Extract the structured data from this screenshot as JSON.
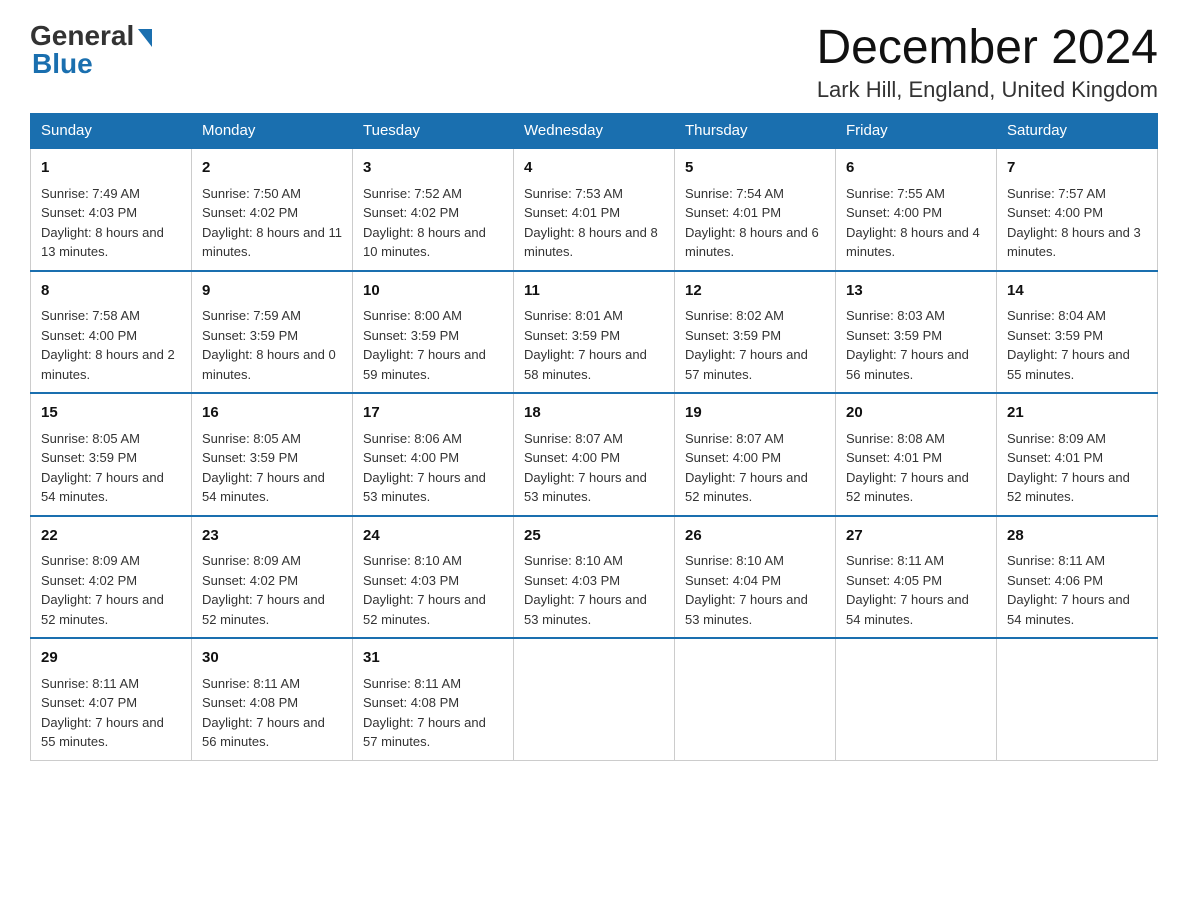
{
  "header": {
    "logo": {
      "general": "General",
      "blue": "Blue"
    },
    "title": "December 2024",
    "subtitle": "Lark Hill, England, United Kingdom"
  },
  "weekdays": [
    "Sunday",
    "Monday",
    "Tuesday",
    "Wednesday",
    "Thursday",
    "Friday",
    "Saturday"
  ],
  "weeks": [
    [
      {
        "day": "1",
        "sunrise": "7:49 AM",
        "sunset": "4:03 PM",
        "daylight": "8 hours and 13 minutes."
      },
      {
        "day": "2",
        "sunrise": "7:50 AM",
        "sunset": "4:02 PM",
        "daylight": "8 hours and 11 minutes."
      },
      {
        "day": "3",
        "sunrise": "7:52 AM",
        "sunset": "4:02 PM",
        "daylight": "8 hours and 10 minutes."
      },
      {
        "day": "4",
        "sunrise": "7:53 AM",
        "sunset": "4:01 PM",
        "daylight": "8 hours and 8 minutes."
      },
      {
        "day": "5",
        "sunrise": "7:54 AM",
        "sunset": "4:01 PM",
        "daylight": "8 hours and 6 minutes."
      },
      {
        "day": "6",
        "sunrise": "7:55 AM",
        "sunset": "4:00 PM",
        "daylight": "8 hours and 4 minutes."
      },
      {
        "day": "7",
        "sunrise": "7:57 AM",
        "sunset": "4:00 PM",
        "daylight": "8 hours and 3 minutes."
      }
    ],
    [
      {
        "day": "8",
        "sunrise": "7:58 AM",
        "sunset": "4:00 PM",
        "daylight": "8 hours and 2 minutes."
      },
      {
        "day": "9",
        "sunrise": "7:59 AM",
        "sunset": "3:59 PM",
        "daylight": "8 hours and 0 minutes."
      },
      {
        "day": "10",
        "sunrise": "8:00 AM",
        "sunset": "3:59 PM",
        "daylight": "7 hours and 59 minutes."
      },
      {
        "day": "11",
        "sunrise": "8:01 AM",
        "sunset": "3:59 PM",
        "daylight": "7 hours and 58 minutes."
      },
      {
        "day": "12",
        "sunrise": "8:02 AM",
        "sunset": "3:59 PM",
        "daylight": "7 hours and 57 minutes."
      },
      {
        "day": "13",
        "sunrise": "8:03 AM",
        "sunset": "3:59 PM",
        "daylight": "7 hours and 56 minutes."
      },
      {
        "day": "14",
        "sunrise": "8:04 AM",
        "sunset": "3:59 PM",
        "daylight": "7 hours and 55 minutes."
      }
    ],
    [
      {
        "day": "15",
        "sunrise": "8:05 AM",
        "sunset": "3:59 PM",
        "daylight": "7 hours and 54 minutes."
      },
      {
        "day": "16",
        "sunrise": "8:05 AM",
        "sunset": "3:59 PM",
        "daylight": "7 hours and 54 minutes."
      },
      {
        "day": "17",
        "sunrise": "8:06 AM",
        "sunset": "4:00 PM",
        "daylight": "7 hours and 53 minutes."
      },
      {
        "day": "18",
        "sunrise": "8:07 AM",
        "sunset": "4:00 PM",
        "daylight": "7 hours and 53 minutes."
      },
      {
        "day": "19",
        "sunrise": "8:07 AM",
        "sunset": "4:00 PM",
        "daylight": "7 hours and 52 minutes."
      },
      {
        "day": "20",
        "sunrise": "8:08 AM",
        "sunset": "4:01 PM",
        "daylight": "7 hours and 52 minutes."
      },
      {
        "day": "21",
        "sunrise": "8:09 AM",
        "sunset": "4:01 PM",
        "daylight": "7 hours and 52 minutes."
      }
    ],
    [
      {
        "day": "22",
        "sunrise": "8:09 AM",
        "sunset": "4:02 PM",
        "daylight": "7 hours and 52 minutes."
      },
      {
        "day": "23",
        "sunrise": "8:09 AM",
        "sunset": "4:02 PM",
        "daylight": "7 hours and 52 minutes."
      },
      {
        "day": "24",
        "sunrise": "8:10 AM",
        "sunset": "4:03 PM",
        "daylight": "7 hours and 52 minutes."
      },
      {
        "day": "25",
        "sunrise": "8:10 AM",
        "sunset": "4:03 PM",
        "daylight": "7 hours and 53 minutes."
      },
      {
        "day": "26",
        "sunrise": "8:10 AM",
        "sunset": "4:04 PM",
        "daylight": "7 hours and 53 minutes."
      },
      {
        "day": "27",
        "sunrise": "8:11 AM",
        "sunset": "4:05 PM",
        "daylight": "7 hours and 54 minutes."
      },
      {
        "day": "28",
        "sunrise": "8:11 AM",
        "sunset": "4:06 PM",
        "daylight": "7 hours and 54 minutes."
      }
    ],
    [
      {
        "day": "29",
        "sunrise": "8:11 AM",
        "sunset": "4:07 PM",
        "daylight": "7 hours and 55 minutes."
      },
      {
        "day": "30",
        "sunrise": "8:11 AM",
        "sunset": "4:08 PM",
        "daylight": "7 hours and 56 minutes."
      },
      {
        "day": "31",
        "sunrise": "8:11 AM",
        "sunset": "4:08 PM",
        "daylight": "7 hours and 57 minutes."
      },
      null,
      null,
      null,
      null
    ]
  ],
  "labels": {
    "sunrise": "Sunrise:",
    "sunset": "Sunset:",
    "daylight": "Daylight:"
  }
}
